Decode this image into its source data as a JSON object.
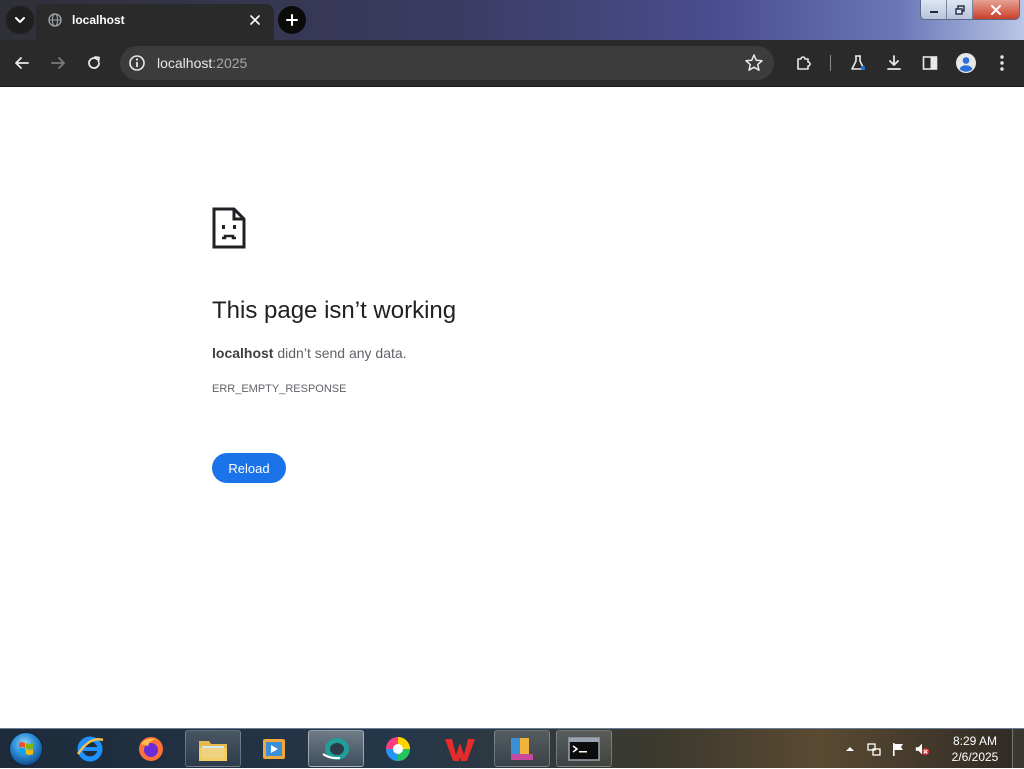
{
  "browser": {
    "tab": {
      "title": "localhost",
      "favicon": "globe-icon"
    },
    "url": {
      "host": "localhost",
      "port": ":2025"
    },
    "toolbar_icons": [
      "back-icon",
      "forward-icon",
      "reload-icon",
      "site-info-icon",
      "bookmark-star-icon",
      "extensions-icon",
      "labs-flask-icon",
      "download-icon",
      "side-panel-icon",
      "profile-icon",
      "menu-icon"
    ]
  },
  "page": {
    "title": "This page isn’t working",
    "host_bold": "localhost",
    "description_rest": " didn’t send any data.",
    "error_code": "ERR_EMPTY_RESPONSE",
    "reload_label": "Reload"
  },
  "taskbar": {
    "apps": [
      "internet-explorer",
      "firefox",
      "file-explorer",
      "media-player",
      "app-teal",
      "app-color-wheel",
      "wps-office",
      "archive-manager",
      "command-prompt"
    ],
    "time": "8:29 AM",
    "date": "2/6/2025"
  },
  "colors": {
    "reload_button": "#1a73e8",
    "title_text": "#202124",
    "body_text": "#5f6368",
    "toolbar_bg": "#2a2a2a"
  }
}
